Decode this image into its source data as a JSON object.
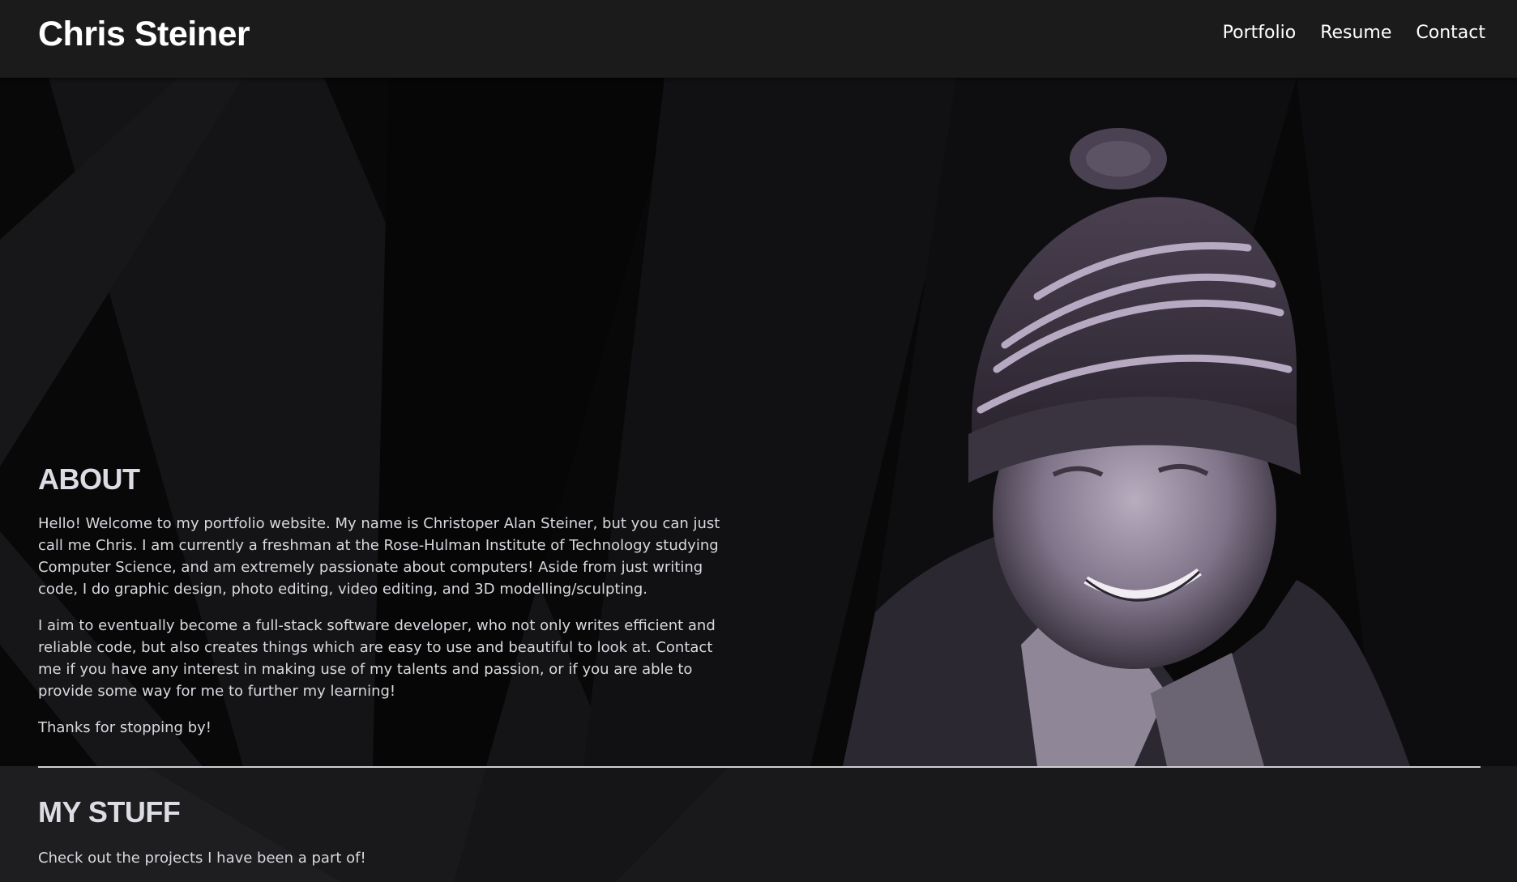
{
  "header": {
    "brand": "Chris Steiner",
    "nav": [
      "Portfolio",
      "Resume",
      "Contact"
    ]
  },
  "about": {
    "heading": "ABOUT",
    "paragraphs": [
      "Hello! Welcome to my portfolio website. My name is Christoper Alan Steiner, but you can just call me Chris. I am currently a freshman at the Rose-Hulman Institute of Technology studying Computer Science, and am extremely passionate about computers! Aside from just writing code, I do graphic design, photo editing, video editing, and 3D modelling/sculpting.",
      "I aim to eventually become a full-stack software developer, who not only writes efficient and reliable code, but also creates things which are easy to use and beautiful to look at. Contact me if you have any interest in making use of my talents and passion, or if you are able to provide some way for me to further my learning!",
      "Thanks for stopping by!"
    ]
  },
  "stuff": {
    "heading": "MY STUFF",
    "text": "Check out the projects I have been a part of!"
  },
  "colors": {
    "header_bg": "#1b1b1c",
    "page_bg": "#080809",
    "text": "#d8d8de",
    "portrait_tint": "#8a7f96"
  },
  "icons": {
    "portrait": "portrait-photo"
  }
}
